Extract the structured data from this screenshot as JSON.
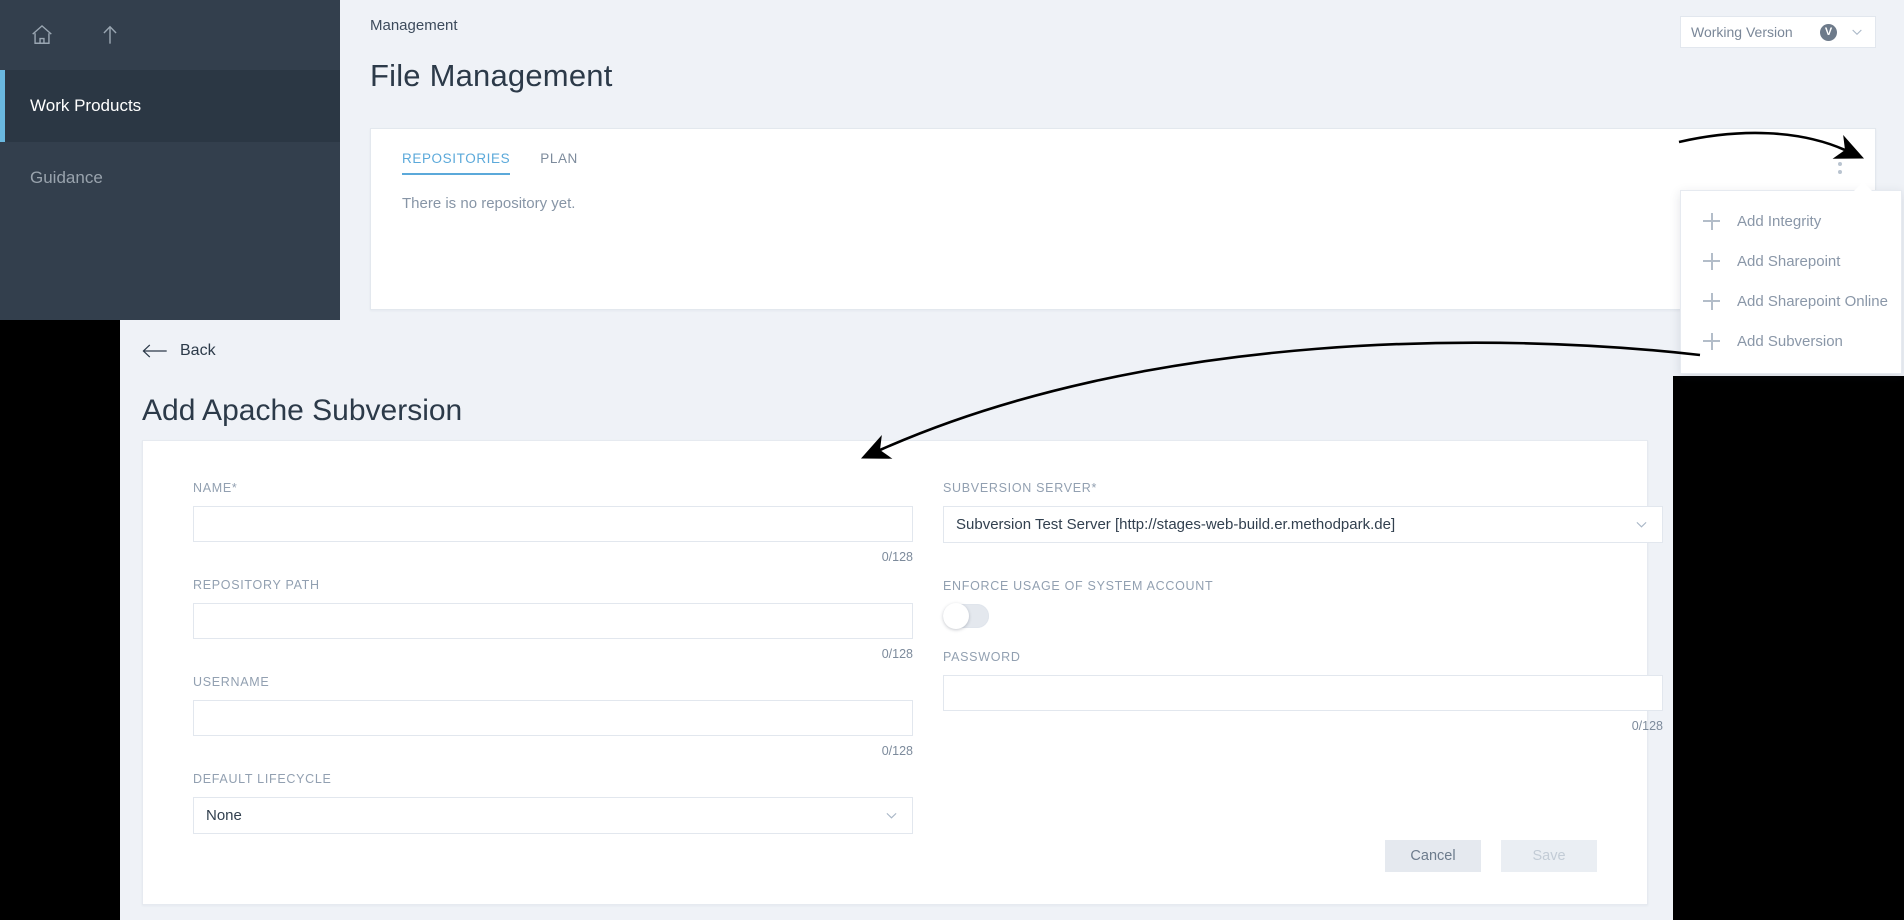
{
  "sidebar": {
    "icons": [
      {
        "name": "home-icon",
        "label": "Home"
      },
      {
        "name": "up-arrow-icon",
        "label": "Up"
      }
    ],
    "items": [
      {
        "label": "Work Products",
        "active": true
      },
      {
        "label": "Guidance",
        "active": false
      }
    ]
  },
  "header": {
    "breadcrumb": "Management",
    "page_title": "File Management",
    "version_selector": {
      "label": "Working Version",
      "badge": "V",
      "chevron": "chevron-down-icon"
    }
  },
  "card": {
    "tabs": [
      {
        "label": "REPOSITORIES",
        "active": true
      },
      {
        "label": "PLAN",
        "active": false
      }
    ],
    "empty_message": "There is no repository yet.",
    "kebab_menu": "more-options-icon"
  },
  "popover": {
    "items": [
      {
        "label": "Add Integrity",
        "icon": "plus-icon"
      },
      {
        "label": "Add Sharepoint",
        "icon": "plus-icon"
      },
      {
        "label": "Add Sharepoint Online",
        "icon": "plus-icon"
      },
      {
        "label": "Add Subversion",
        "icon": "plus-icon"
      }
    ]
  },
  "detail": {
    "back_label": "Back",
    "title": "Add Apache Subversion",
    "fields": {
      "name": {
        "label": "NAME*",
        "value": "",
        "placeholder": "",
        "counter": "0/128"
      },
      "repository_path": {
        "label": "REPOSITORY PATH",
        "value": "",
        "placeholder": "",
        "counter": "0/128"
      },
      "username": {
        "label": "USERNAME",
        "value": "",
        "placeholder": "",
        "counter": "0/128"
      },
      "default_lifecycle": {
        "label": "DEFAULT LIFECYCLE",
        "value": "None"
      },
      "subversion_server": {
        "label": "SUBVERSION SERVER*",
        "value": "Subversion Test Server [http://stages-web-build.er.methodpark.de]"
      },
      "enforce_system_account": {
        "label": "ENFORCE USAGE OF SYSTEM ACCOUNT",
        "state": "off"
      },
      "password": {
        "label": "PASSWORD",
        "value": "",
        "placeholder": "",
        "counter": "0/128"
      }
    },
    "buttons": {
      "cancel": "Cancel",
      "save": "Save"
    }
  },
  "colors": {
    "sidebar_bg": "#333f4d",
    "sidebar_active_bg": "#2b3744",
    "accent_blue": "#5ba9da",
    "page_bg": "#eff2f7",
    "card_bg": "#ffffff",
    "label_grey": "#92a0b1",
    "title_dark": "#2c3a49"
  }
}
